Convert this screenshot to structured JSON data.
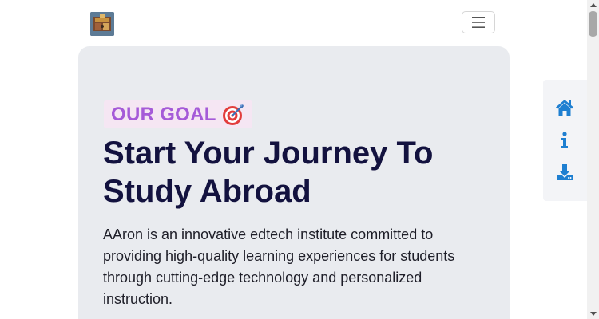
{
  "navbar": {
    "logo_icon": "institute-logo",
    "menu_icon": "hamburger-menu-icon"
  },
  "hero": {
    "badge_text": "OUR GOAL",
    "badge_icon": "target-icon",
    "title": "Start Your Journey To Study Abroad",
    "description": "AAron is an innovative edtech institute committed to providing high-quality learning experiences for students through cutting-edge technology and personalized instruction."
  },
  "side_panel": {
    "items": [
      {
        "icon": "home-icon"
      },
      {
        "icon": "info-icon"
      },
      {
        "icon": "download-icon"
      }
    ]
  },
  "colors": {
    "accent_blue": "#1e7fd1",
    "badge_text": "#a55ad8",
    "badge_bg": "#f5e6f3",
    "title": "#13123f",
    "hero_bg": "#e9ebef"
  }
}
